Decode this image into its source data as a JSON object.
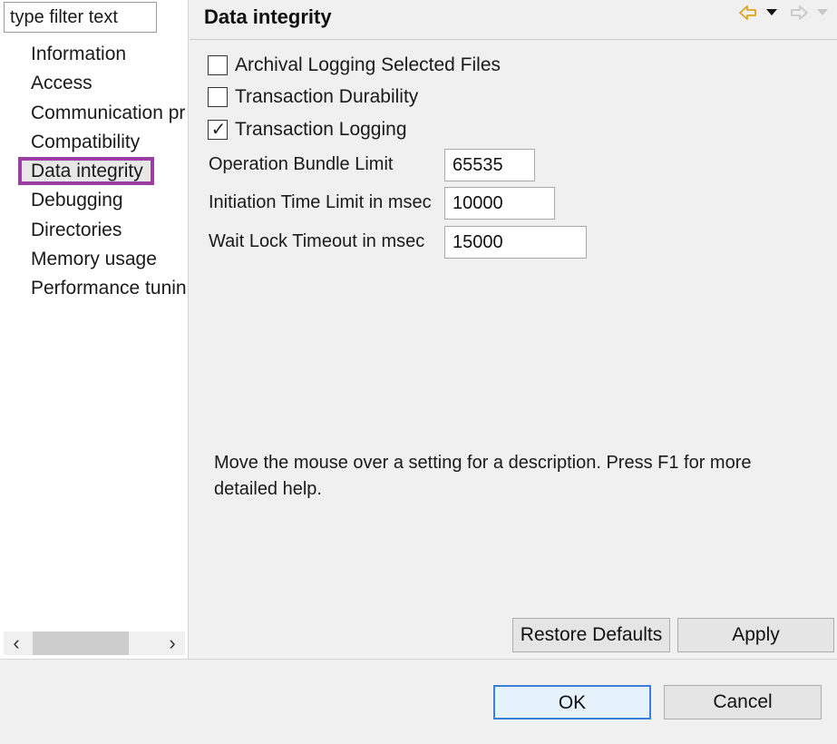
{
  "filter": {
    "value": "type filter text"
  },
  "nav": {
    "items": [
      {
        "label": "Information"
      },
      {
        "label": "Access"
      },
      {
        "label": "Communication pr"
      },
      {
        "label": "Compatibility"
      },
      {
        "label": "Data integrity",
        "selected": true
      },
      {
        "label": "Debugging"
      },
      {
        "label": "Directories"
      },
      {
        "label": "Memory usage"
      },
      {
        "label": "Performance tuning"
      }
    ],
    "scroll_left_icon": "‹",
    "scroll_right_icon": "›"
  },
  "header": {
    "title": "Data integrity",
    "icons": {
      "back": "back-arrow-icon",
      "back_menu": "dropdown-icon",
      "forward": "forward-arrow-icon",
      "forward_menu": "dropdown-icon"
    }
  },
  "settings": {
    "checkboxes": [
      {
        "label": "Archival Logging Selected Files",
        "checked": false
      },
      {
        "label": "Transaction Durability",
        "checked": false
      },
      {
        "label": "Transaction Logging",
        "checked": true
      }
    ],
    "fields": [
      {
        "label": "Operation Bundle Limit",
        "value": "65535"
      },
      {
        "label": "Initiation Time Limit in msec",
        "value": "10000"
      },
      {
        "label": "Wait Lock Timeout in msec",
        "value": "15000"
      }
    ]
  },
  "help_text": "Move the mouse over a setting for a description. Press F1 for more detailed help.",
  "buttons": {
    "restore_defaults": "Restore Defaults",
    "apply": "Apply",
    "ok": "OK",
    "cancel": "Cancel"
  },
  "colors": {
    "selection_outline": "#9b3fa3",
    "default_button_border": "#3b7fd4",
    "back_arrow": "#d9a41a"
  }
}
